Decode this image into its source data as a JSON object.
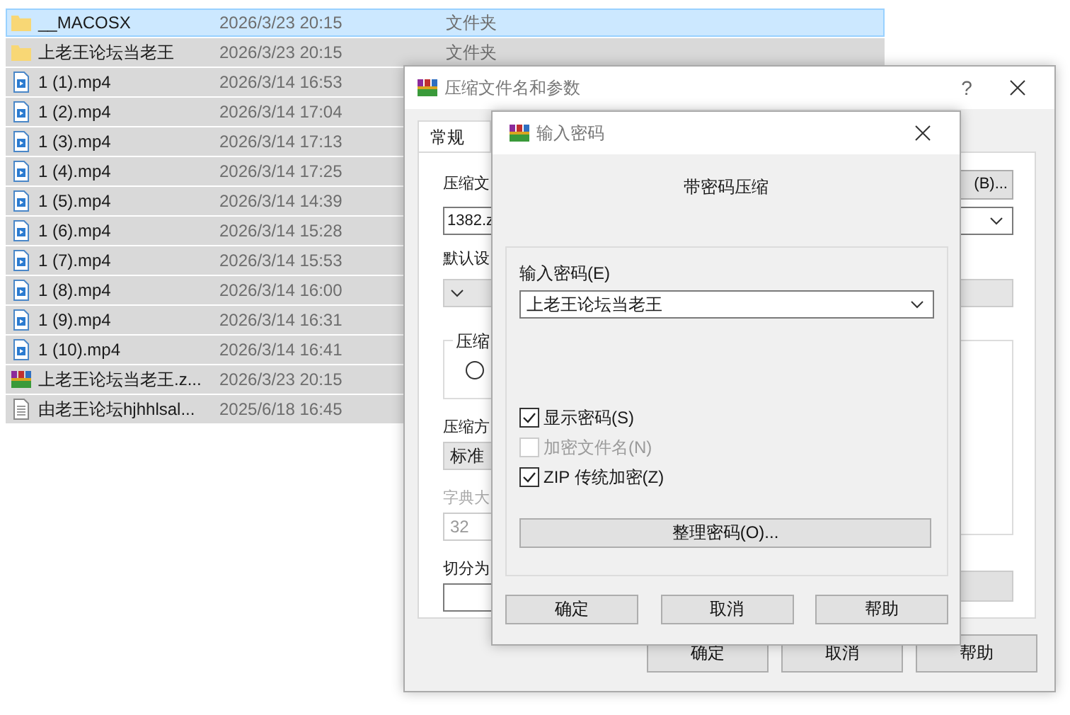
{
  "files": [
    {
      "name": "__MACOSX",
      "modified": "2026/3/23 20:15",
      "type": "文件夹",
      "kind": "folder",
      "selected": true,
      "focused": true
    },
    {
      "name": "上老王论坛当老王",
      "modified": "2026/3/23 20:15",
      "type": "文件夹",
      "kind": "folder",
      "selected": true,
      "focused": false
    },
    {
      "name": "1 (1).mp4",
      "modified": "2026/3/14 16:53",
      "kind": "video",
      "selected": true,
      "focused": false
    },
    {
      "name": "1 (2).mp4",
      "modified": "2026/3/14 17:04",
      "kind": "video",
      "selected": true,
      "focused": false
    },
    {
      "name": "1 (3).mp4",
      "modified": "2026/3/14 17:13",
      "kind": "video",
      "selected": true,
      "focused": false
    },
    {
      "name": "1 (4).mp4",
      "modified": "2026/3/14 17:25",
      "kind": "video",
      "selected": true,
      "focused": false
    },
    {
      "name": "1 (5).mp4",
      "modified": "2026/3/14 14:39",
      "kind": "video",
      "selected": true,
      "focused": false
    },
    {
      "name": "1 (6).mp4",
      "modified": "2026/3/14 15:28",
      "kind": "video",
      "selected": true,
      "focused": false
    },
    {
      "name": "1 (7).mp4",
      "modified": "2026/3/14 15:53",
      "kind": "video",
      "selected": true,
      "focused": false
    },
    {
      "name": "1 (8).mp4",
      "modified": "2026/3/14 16:00",
      "kind": "video",
      "selected": true,
      "focused": false
    },
    {
      "name": "1 (9).mp4",
      "modified": "2026/3/14 16:31",
      "kind": "video",
      "selected": true,
      "focused": false
    },
    {
      "name": "1 (10).mp4",
      "modified": "2026/3/14 16:41",
      "kind": "video",
      "selected": true,
      "focused": false
    },
    {
      "name": "上老王论坛当老王.z...",
      "modified": "2026/3/23 20:15",
      "kind": "archive",
      "selected": true,
      "focused": false
    },
    {
      "name": "由老王论坛hjhhlsal...",
      "modified": "2025/6/18 16:45",
      "kind": "text",
      "selected": true,
      "focused": false
    }
  ],
  "archive_dialog": {
    "title": "压缩文件名和参数",
    "help": "?",
    "tabs": [
      {
        "label": "常规",
        "selected": true
      }
    ],
    "archive_name_label": "压缩文",
    "browse_button": "(B)...",
    "archive_name_value": "1382.z",
    "default_label": "默认设",
    "group_label": "压缩",
    "format_option": {
      "selected": false
    },
    "method_label": "压缩方",
    "method_value": "标准",
    "dictionary_label": "字典大",
    "dictionary_value": "32",
    "split_label": "切分为",
    "buttons": [
      "确定",
      "取消",
      "帮助"
    ]
  },
  "password_dialog": {
    "title": "输入密码",
    "heading": "带密码压缩",
    "password_label": "输入密码(E)",
    "password_value": "上老王论坛当老王",
    "options": [
      {
        "label": "显示密码(S)",
        "checked": true,
        "disabled": false
      },
      {
        "label": "加密文件名(N)",
        "checked": false,
        "disabled": true
      },
      {
        "label": "ZIP 传统加密(Z)",
        "checked": true,
        "disabled": false
      }
    ],
    "organize_button": "整理密码(O)...",
    "buttons": [
      "确定",
      "取消",
      "帮助"
    ]
  }
}
